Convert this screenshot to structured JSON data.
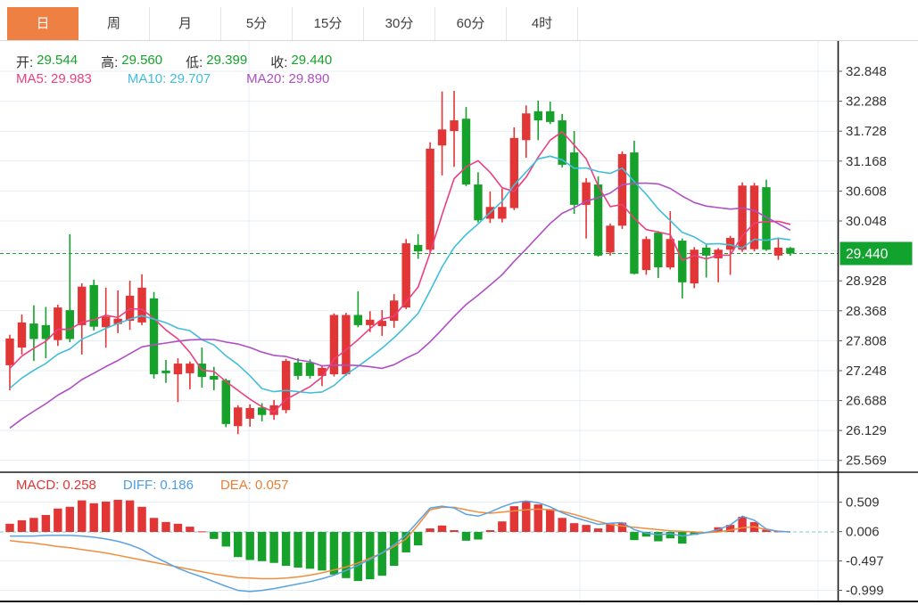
{
  "tabs": {
    "items": [
      {
        "label": "日",
        "active": true
      },
      {
        "label": "周",
        "active": false
      },
      {
        "label": "月",
        "active": false
      },
      {
        "label": "5分",
        "active": false
      },
      {
        "label": "15分",
        "active": false
      },
      {
        "label": "30分",
        "active": false
      },
      {
        "label": "60分",
        "active": false
      },
      {
        "label": "4时",
        "active": false
      }
    ]
  },
  "quote_bar": {
    "open_label": "开:",
    "open": "29.544",
    "high_label": "高:",
    "high": "29.560",
    "low_label": "低:",
    "low": "29.399",
    "close_label": "收:",
    "close": "29.440"
  },
  "ma_bar": {
    "ma5_label": "MA5:",
    "ma5": "29.983",
    "ma10_label": "MA10:",
    "ma10": "29.707",
    "ma20_label": "MA20:",
    "ma20": "29.890"
  },
  "macd_bar": {
    "macd_label": "MACD:",
    "macd": "0.258",
    "diff_label": "DIFF:",
    "diff": "0.186",
    "dea_label": "DEA:",
    "dea": "0.057"
  },
  "price_axis": {
    "labels": [
      {
        "v": 32.848,
        "t": "32.848"
      },
      {
        "v": 32.288,
        "t": "32.288"
      },
      {
        "v": 31.728,
        "t": "31.728"
      },
      {
        "v": 31.168,
        "t": "31.168"
      },
      {
        "v": 30.608,
        "t": "30.608"
      },
      {
        "v": 30.048,
        "t": "30.048"
      },
      {
        "v": 28.928,
        "t": "28.928"
      },
      {
        "v": 28.368,
        "t": "28.368"
      },
      {
        "v": 27.808,
        "t": "27.808"
      },
      {
        "v": 27.248,
        "t": "27.248"
      },
      {
        "v": 26.688,
        "t": "26.688"
      },
      {
        "v": 26.129,
        "t": "26.129"
      },
      {
        "v": 25.569,
        "t": "25.569"
      }
    ],
    "current_price_label": "29.440"
  },
  "macd_axis": {
    "labels": [
      {
        "v": 0.509,
        "t": "0.509"
      },
      {
        "v": 0.006,
        "t": "0.006"
      },
      {
        "v": -0.497,
        "t": "-0.497"
      },
      {
        "v": -0.999,
        "t": "-0.999"
      }
    ]
  },
  "colors": {
    "up": "#e23535",
    "down": "#16a12b",
    "ma5": "#ec3f80",
    "ma10": "#41bedc",
    "ma20": "#b04fc4",
    "diff_line": "#5aa2e0",
    "dea_line": "#ef8e3e",
    "tab_accent": "#ee8044",
    "price_badge": "#12a22e",
    "grid": "#e7edf4",
    "axis_line": "#1a1a1a",
    "tick_text": "#333333",
    "dashed_price": "#1ba12e",
    "macd_zero": "#7ec9c9"
  },
  "chart_data": {
    "type": "candlestick+macd",
    "title": "",
    "price_axis_range": [
      25.569,
      32.848
    ],
    "macd_axis_range": [
      -0.999,
      0.509
    ],
    "current_price": 29.44,
    "price_gridlines": [
      32.848,
      32.288,
      31.728,
      31.168,
      30.608,
      30.048,
      29.488,
      28.928,
      28.368,
      27.808,
      27.248,
      26.688,
      26.129,
      25.569
    ],
    "macd_gridlines": [
      0.509,
      -0.497,
      -0.999
    ],
    "x_gridlines": [
      279,
      650,
      917
    ],
    "candles": [
      [
        27.35,
        27.92,
        26.88,
        27.85
      ],
      [
        27.68,
        28.3,
        27.55,
        28.15
      ],
      [
        28.13,
        28.47,
        27.43,
        27.84
      ],
      [
        28.1,
        28.44,
        27.48,
        27.84
      ],
      [
        27.82,
        28.48,
        27.71,
        28.43
      ],
      [
        28.38,
        29.8,
        27.78,
        27.84
      ],
      [
        28.1,
        28.88,
        27.55,
        28.82
      ],
      [
        28.85,
        28.95,
        28.0,
        28.07
      ],
      [
        28.06,
        28.8,
        27.68,
        28.26
      ],
      [
        28.12,
        28.75,
        27.95,
        28.22
      ],
      [
        28.18,
        28.93,
        28.01,
        28.65
      ],
      [
        28.15,
        29.05,
        28.1,
        28.8
      ],
      [
        28.6,
        28.72,
        27.1,
        27.18
      ],
      [
        27.25,
        27.45,
        27.02,
        27.2
      ],
      [
        27.18,
        27.48,
        26.66,
        27.38
      ],
      [
        27.2,
        27.42,
        26.9,
        27.38
      ],
      [
        27.38,
        27.68,
        26.93,
        27.13
      ],
      [
        27.15,
        27.32,
        26.88,
        27.08
      ],
      [
        27.07,
        27.1,
        26.19,
        26.25
      ],
      [
        26.21,
        26.6,
        26.06,
        26.56
      ],
      [
        26.35,
        26.62,
        26.2,
        26.55
      ],
      [
        26.56,
        26.64,
        26.3,
        26.42
      ],
      [
        26.42,
        26.7,
        26.33,
        26.6
      ],
      [
        26.51,
        27.47,
        26.45,
        27.43
      ],
      [
        27.4,
        27.48,
        27.08,
        27.15
      ],
      [
        27.4,
        27.46,
        27.1,
        27.15
      ],
      [
        27.15,
        27.35,
        26.96,
        27.3
      ],
      [
        27.18,
        28.32,
        27.14,
        28.29
      ],
      [
        27.18,
        28.33,
        27.15,
        28.29
      ],
      [
        28.29,
        28.73,
        28.06,
        28.1
      ],
      [
        28.1,
        28.36,
        27.97,
        28.2
      ],
      [
        28.08,
        28.38,
        27.9,
        28.18
      ],
      [
        28.18,
        28.68,
        28.05,
        28.56
      ],
      [
        28.43,
        29.71,
        28.4,
        29.63
      ],
      [
        29.6,
        29.8,
        29.34,
        29.48
      ],
      [
        29.51,
        31.52,
        29.45,
        31.4
      ],
      [
        31.46,
        32.47,
        30.9,
        31.76
      ],
      [
        31.73,
        32.48,
        31.06,
        31.93
      ],
      [
        31.96,
        32.18,
        30.7,
        30.73
      ],
      [
        30.73,
        30.96,
        30.02,
        30.06
      ],
      [
        30.09,
        30.6,
        30.01,
        30.31
      ],
      [
        30.09,
        30.65,
        30.02,
        30.31
      ],
      [
        30.29,
        31.8,
        30.25,
        31.6
      ],
      [
        31.56,
        32.21,
        31.23,
        32.06
      ],
      [
        32.1,
        32.3,
        31.56,
        31.93
      ],
      [
        32.1,
        32.28,
        31.86,
        31.9
      ],
      [
        31.93,
        32.05,
        31.05,
        31.1
      ],
      [
        31.33,
        31.73,
        30.18,
        30.35
      ],
      [
        30.35,
        30.85,
        29.72,
        30.77
      ],
      [
        30.73,
        30.88,
        29.38,
        29.4
      ],
      [
        29.46,
        30.0,
        29.4,
        29.96
      ],
      [
        29.96,
        31.35,
        29.9,
        31.3
      ],
      [
        31.33,
        31.55,
        29.05,
        29.06
      ],
      [
        29.13,
        29.76,
        29.04,
        29.71
      ],
      [
        29.83,
        29.86,
        28.98,
        29.18
      ],
      [
        29.18,
        30.23,
        29.14,
        29.71
      ],
      [
        29.68,
        29.72,
        28.6,
        28.9
      ],
      [
        28.88,
        29.56,
        28.79,
        29.51
      ],
      [
        29.55,
        29.61,
        28.99,
        29.4
      ],
      [
        29.35,
        29.54,
        28.9,
        29.51
      ],
      [
        29.51,
        29.77,
        29.04,
        29.73
      ],
      [
        29.51,
        30.77,
        29.47,
        30.71
      ],
      [
        29.52,
        30.76,
        29.48,
        30.71
      ],
      [
        30.68,
        30.82,
        29.49,
        29.51
      ],
      [
        29.4,
        29.74,
        29.32,
        29.55
      ],
      [
        29.544,
        29.56,
        29.399,
        29.44
      ]
    ],
    "ma_periods": [
      5,
      10,
      20
    ],
    "pre_history_closes_for_ma": [
      24.6,
      24.75,
      24.9,
      25.05,
      25.2,
      25.35,
      25.5,
      25.65,
      25.8,
      25.95,
      26.1,
      26.25,
      26.4,
      26.55,
      26.7,
      26.85,
      27.0,
      27.1,
      27.2,
      27.3
    ],
    "macd": {
      "hist": [
        0.14,
        0.2,
        0.24,
        0.29,
        0.4,
        0.43,
        0.54,
        0.49,
        0.52,
        0.55,
        0.54,
        0.43,
        0.24,
        0.17,
        0.14,
        0.09,
        0.01,
        -0.12,
        -0.25,
        -0.43,
        -0.48,
        -0.5,
        -0.53,
        -0.58,
        -0.61,
        -0.63,
        -0.66,
        -0.73,
        -0.79,
        -0.84,
        -0.81,
        -0.75,
        -0.58,
        -0.35,
        -0.23,
        0.06,
        0.11,
        0.03,
        -0.15,
        -0.13,
        0.03,
        0.18,
        0.44,
        0.52,
        0.47,
        0.39,
        0.24,
        0.15,
        0.12,
        0.06,
        0.15,
        0.16,
        -0.14,
        -0.08,
        -0.16,
        -0.11,
        -0.2,
        -0.05,
        -0.01,
        0.08,
        0.12,
        0.26,
        0.17,
        0.04,
        0.01,
        0.0
      ],
      "diff": [
        -0.07,
        -0.07,
        -0.07,
        -0.06,
        -0.06,
        -0.06,
        -0.07,
        -0.09,
        -0.12,
        -0.16,
        -0.22,
        -0.3,
        -0.42,
        -0.52,
        -0.62,
        -0.7,
        -0.77,
        -0.85,
        -0.93,
        -1.0,
        -1.02,
        -1.0,
        -0.97,
        -0.93,
        -0.89,
        -0.85,
        -0.8,
        -0.74,
        -0.66,
        -0.57,
        -0.47,
        -0.36,
        -0.22,
        -0.05,
        0.18,
        0.41,
        0.44,
        0.41,
        0.3,
        0.27,
        0.34,
        0.43,
        0.5,
        0.53,
        0.5,
        0.43,
        0.33,
        0.25,
        0.19,
        0.13,
        0.15,
        0.16,
        0.04,
        -0.02,
        -0.05,
        -0.03,
        -0.07,
        -0.04,
        -0.01,
        0.04,
        0.12,
        0.27,
        0.2,
        0.05,
        0.01,
        0.0
      ],
      "dea": [
        -0.15,
        -0.17,
        -0.19,
        -0.22,
        -0.25,
        -0.27,
        -0.3,
        -0.33,
        -0.36,
        -0.4,
        -0.44,
        -0.48,
        -0.52,
        -0.56,
        -0.6,
        -0.64,
        -0.68,
        -0.72,
        -0.75,
        -0.78,
        -0.79,
        -0.8,
        -0.8,
        -0.79,
        -0.77,
        -0.74,
        -0.7,
        -0.65,
        -0.6,
        -0.53,
        -0.45,
        -0.36,
        -0.25,
        -0.12,
        0.12,
        0.38,
        0.42,
        0.42,
        0.38,
        0.34,
        0.32,
        0.34,
        0.36,
        0.38,
        0.39,
        0.38,
        0.35,
        0.3,
        0.24,
        0.18,
        0.13,
        0.1,
        0.08,
        0.06,
        0.04,
        0.02,
        0.01,
        0.0,
        -0.01,
        0.0,
        0.03,
        0.07,
        0.09,
        0.04,
        0.01,
        0.0
      ]
    }
  }
}
